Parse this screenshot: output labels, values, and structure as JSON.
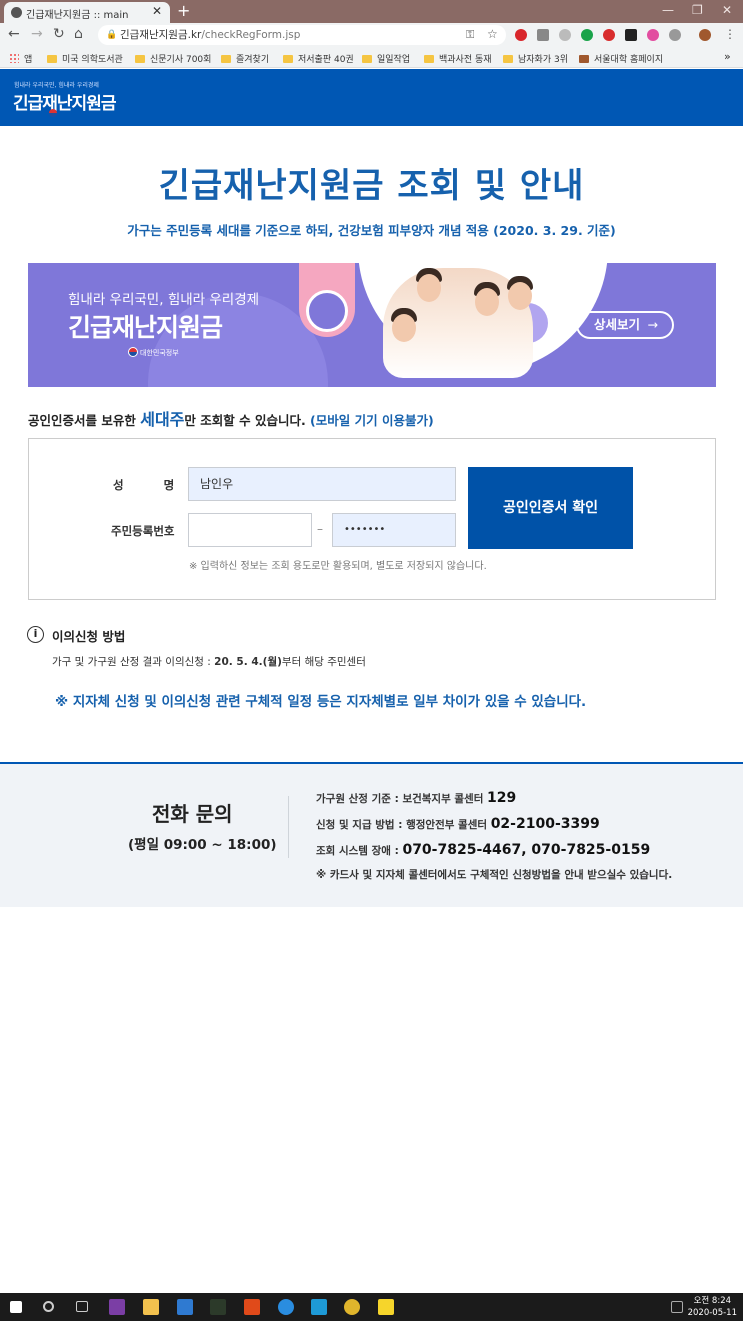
{
  "browser": {
    "tab_title": "긴급재난지원금 :: main",
    "new_tab": "+",
    "url_host": "긴급재난지원금.kr",
    "url_path": "/checkRegForm.jsp",
    "bookmarks": [
      "앱",
      "미국 의학도서관",
      "신문기사 700회",
      "즐겨찾기",
      "저서출판 40권",
      "일일작업",
      "백과사전 동재",
      "남자화가 3위",
      "서울대학 홈페이지"
    ],
    "bookmarks_more": "»"
  },
  "header": {
    "logo_tagline": "힘내라 우리국민, 힘내라 우리경제",
    "logo_title": "긴급재난지원금"
  },
  "main": {
    "title": "긴급재난지원금 조회 및 안내",
    "subtitle": "가구는 주민등록 세대를 기준으로 하되, 건강보험 피부양자 개념 적용 (2020. 3. 29. 기준)"
  },
  "banner": {
    "tagline": "힘내라 우리국민, 힘내라 우리경제",
    "title": "긴급재난지원금",
    "gov": "대한민국정부",
    "button": "상세보기",
    "button_arrow": "→"
  },
  "notice": {
    "prefix": "공인인증서를 보유한 ",
    "emphasis": "세대주",
    "suffix": "만 조회할 수 있습니다. ",
    "mobile": "(모바일 기기 이용불가)"
  },
  "form": {
    "name_label": "성          명",
    "name_value": "남인우",
    "rrn_label": "주민등록번호",
    "rrn_front_value": "",
    "rrn_back_value": "•••••••",
    "dash": "–",
    "confirm_button": "공인인증서 확인",
    "note": "※ 입력하신 정보는 조회 용도로만 활용되며, 별도로 저장되지 않습니다."
  },
  "objection": {
    "icon": "i",
    "title": "이의신청 방법",
    "text_prefix": "가구 및 가구원 산정 결과 이의신청 : ",
    "text_date": "20. 5. 4.(월)",
    "text_suffix": "부터 해당 주민센터"
  },
  "region_note": "※ 지자체 신청 및 이의신청 관련 구체적 일정 등은 지자체별로 일부 차이가 있을 수 있습니다.",
  "footer": {
    "title": "전화 문의",
    "hours": "(평일 09:00 ~ 18:00)",
    "line1_label": "가구원 산정 기준 : 보건복지부 콜센터 ",
    "line1_num": "129",
    "line2_label": "신청 및 지급 방법 : 행정안전부 콜센터 ",
    "line2_num": "02-2100-3399",
    "line3_label": "조회 시스템 장애 : ",
    "line3_num": "070-7825-4467, 070-7825-0159",
    "line4": "※ 카드사 및 지자체 콜센터에서도 구체적인 신청방법을 안내 받으실수 있습니다."
  },
  "taskbar": {
    "time": "오전 8:24",
    "date": "2020-05-11"
  },
  "colors": {
    "brand_blue": "#0057b4",
    "title_blue": "#1661ad",
    "banner_purple": "#7f77d9"
  }
}
